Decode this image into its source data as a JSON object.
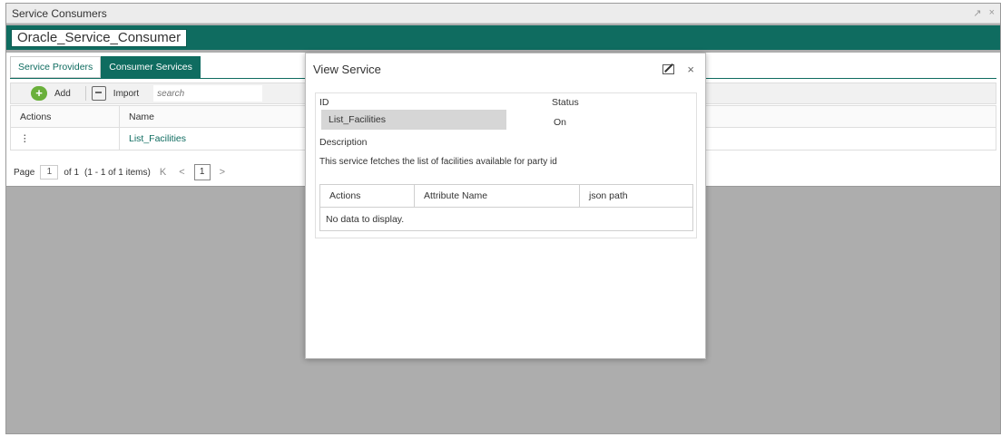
{
  "window": {
    "title": "Service Consumers",
    "controls": [
      "↗",
      "×"
    ]
  },
  "consumer": {
    "name": "Oracle_Service_Consumer"
  },
  "tabs": [
    {
      "label": "Service Providers",
      "active": false
    },
    {
      "label": "Consumer Services",
      "active": true
    }
  ],
  "toolbar": {
    "add_label": "Add",
    "import_label": "Import",
    "search_placeholder": "search"
  },
  "grid": {
    "columns": [
      "Actions",
      "Name"
    ],
    "rows": [
      {
        "actions": "⋮",
        "name": "List_Facilities"
      }
    ]
  },
  "pager": {
    "page_label": "Page",
    "page_value": "1",
    "of_label": "of 1",
    "items_label": "(1 - 1 of 1 items)",
    "first": "K",
    "prev": "<",
    "current": "1",
    "next": ">"
  },
  "modal": {
    "title": "View Service",
    "id_label": "ID",
    "id_value": "List_Facilities",
    "status_label": "Status",
    "status_value": "On",
    "description_label": "Description",
    "description_value": "This service fetches the list of facilities available for party id",
    "table": {
      "columns": [
        "Actions",
        "Attribute Name",
        "json path"
      ],
      "empty_text": "No data to display."
    }
  },
  "colors": {
    "accent": "#0f6c60",
    "add_icon": "#6ab03b",
    "overlay": "#adadad"
  },
  "icons": [
    "add-icon",
    "import-icon",
    "edit-icon",
    "close-icon",
    "kebab-icon"
  ]
}
